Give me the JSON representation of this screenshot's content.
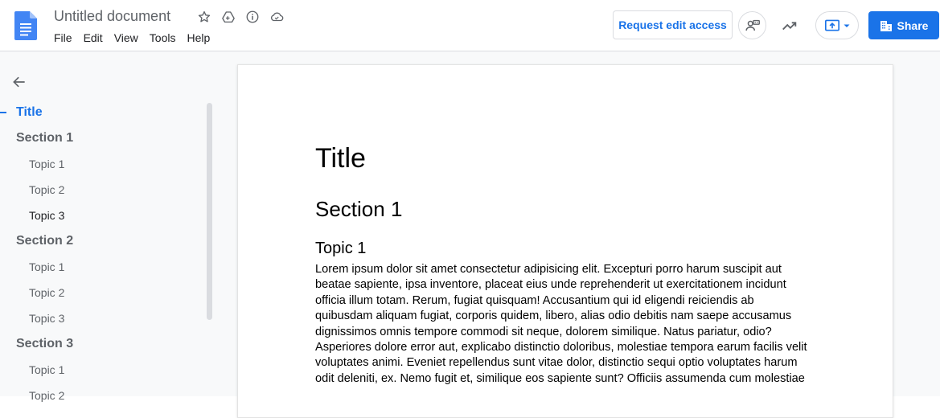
{
  "header": {
    "doc_title": "Untitled document",
    "menu": [
      "File",
      "Edit",
      "View",
      "Tools",
      "Help"
    ],
    "request_edit_label": "Request edit access",
    "share_label": "Share"
  },
  "outline": {
    "items": [
      {
        "label": "Title",
        "level": 1,
        "active": true
      },
      {
        "label": "Section 1",
        "level": 2
      },
      {
        "label": "Topic 1",
        "level": 3
      },
      {
        "label": "Topic 2",
        "level": 3
      },
      {
        "label": "Topic 3",
        "level": 3,
        "dark": true
      },
      {
        "label": "Section 2",
        "level": 2
      },
      {
        "label": "Topic 1",
        "level": 3
      },
      {
        "label": "Topic 2",
        "level": 3
      },
      {
        "label": "Topic 3",
        "level": 3
      },
      {
        "label": "Section 3",
        "level": 2
      },
      {
        "label": "Topic 1",
        "level": 3
      },
      {
        "label": "Topic 2",
        "level": 3
      }
    ]
  },
  "document": {
    "title": "Title",
    "section_heading": "Section 1",
    "topic_heading": "Topic 1",
    "paragraph": "Lorem ipsum dolor sit amet consectetur adipisicing elit. Excepturi porro harum suscipit aut beatae sapiente, ipsa inventore, placeat eius unde reprehenderit ut exercitationem incidunt officia illum totam. Rerum, fugiat quisquam! Accusantium qui id eligendi reiciendis ab quibusdam aliquam fugiat, corporis quidem, libero, alias odio debitis nam saepe accusamus dignissimos omnis tempore commodi sit neque, dolorem similique. Natus pariatur, odio? Asperiores dolore error aut, explicabo distinctio doloribus, molestiae tempora earum facilis velit voluptates animi. Eveniet repellendus sunt vitae dolor, distinctio sequi optio voluptates harum odit deleniti, ex. Nemo fugit et, similique eos sapiente sunt? Officiis assumenda cum molestiae"
  },
  "colors": {
    "accent": "#1a73e8",
    "doc_icon": "#4285f4",
    "muted_text": "#5f6368",
    "canvas": "#f8f9fa"
  }
}
